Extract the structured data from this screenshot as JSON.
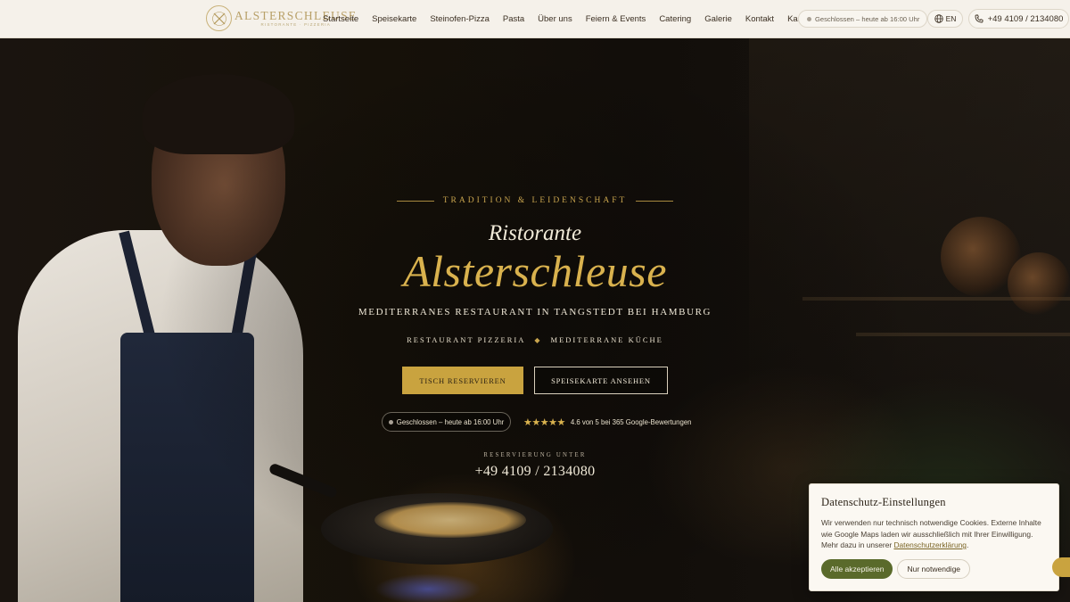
{
  "header": {
    "logo": {
      "name": "ALSTERSCHLEUSE",
      "sub": "RISTORANTE · PIZZERIA",
      "icon": "crossed-cutlery-icon"
    },
    "nav": [
      {
        "label": "Startseite"
      },
      {
        "label": "Speisekarte"
      },
      {
        "label": "Steinofen-Pizza"
      },
      {
        "label": "Pasta"
      },
      {
        "label": "Über uns"
      },
      {
        "label": "Feiern & Events"
      },
      {
        "label": "Catering"
      },
      {
        "label": "Galerie"
      },
      {
        "label": "Kontakt"
      },
      {
        "label": "Karriere"
      }
    ],
    "status": "Geschlossen – heute ab 16:00 Uhr",
    "language": "EN",
    "phone": "+49 4109 / 2134080"
  },
  "hero": {
    "eyebrow": "TRADITION & LEIDENSCHAFT",
    "title_small": "Ristorante",
    "title_big": "Alsterschleuse",
    "subtitle": "MEDITERRANES RESTAURANT IN TANGSTEDT BEI HAMBURG",
    "tags": [
      "RESTAURANT PIZZERIA",
      "MEDITERRANE KÜCHE"
    ],
    "tag_separator": "◆",
    "primary_button": "TISCH RESERVIEREN",
    "secondary_button": "SPEISEKARTE ANSEHEN",
    "status": "Geschlossen – heute ab 16:00 Uhr",
    "rating": {
      "stars": "★★★★★",
      "value": 4.6,
      "max": 5,
      "text": "4.6 von 5 bei 365 Google-Bewertungen"
    },
    "reservation_label": "RESERVIERUNG UNTER",
    "reservation_phone": "+49 4109 / 2134080"
  },
  "cookie": {
    "title": "Datenschutz-Einstellungen",
    "text_before": "Wir verwenden nur technisch notwendige Cookies. Externe Inhalte wie Google Maps laden wir ausschließlich mit Ihrer Einwilligung. Mehr dazu in unserer ",
    "link": "Datenschutzerklärung",
    "text_after": ".",
    "accept": "Alle akzeptieren",
    "necessary": "Nur notwendige"
  },
  "colors": {
    "accent_gold": "#c9a33f",
    "header_bg": "#f5f1ea",
    "accept_green": "#5a6a2b"
  }
}
